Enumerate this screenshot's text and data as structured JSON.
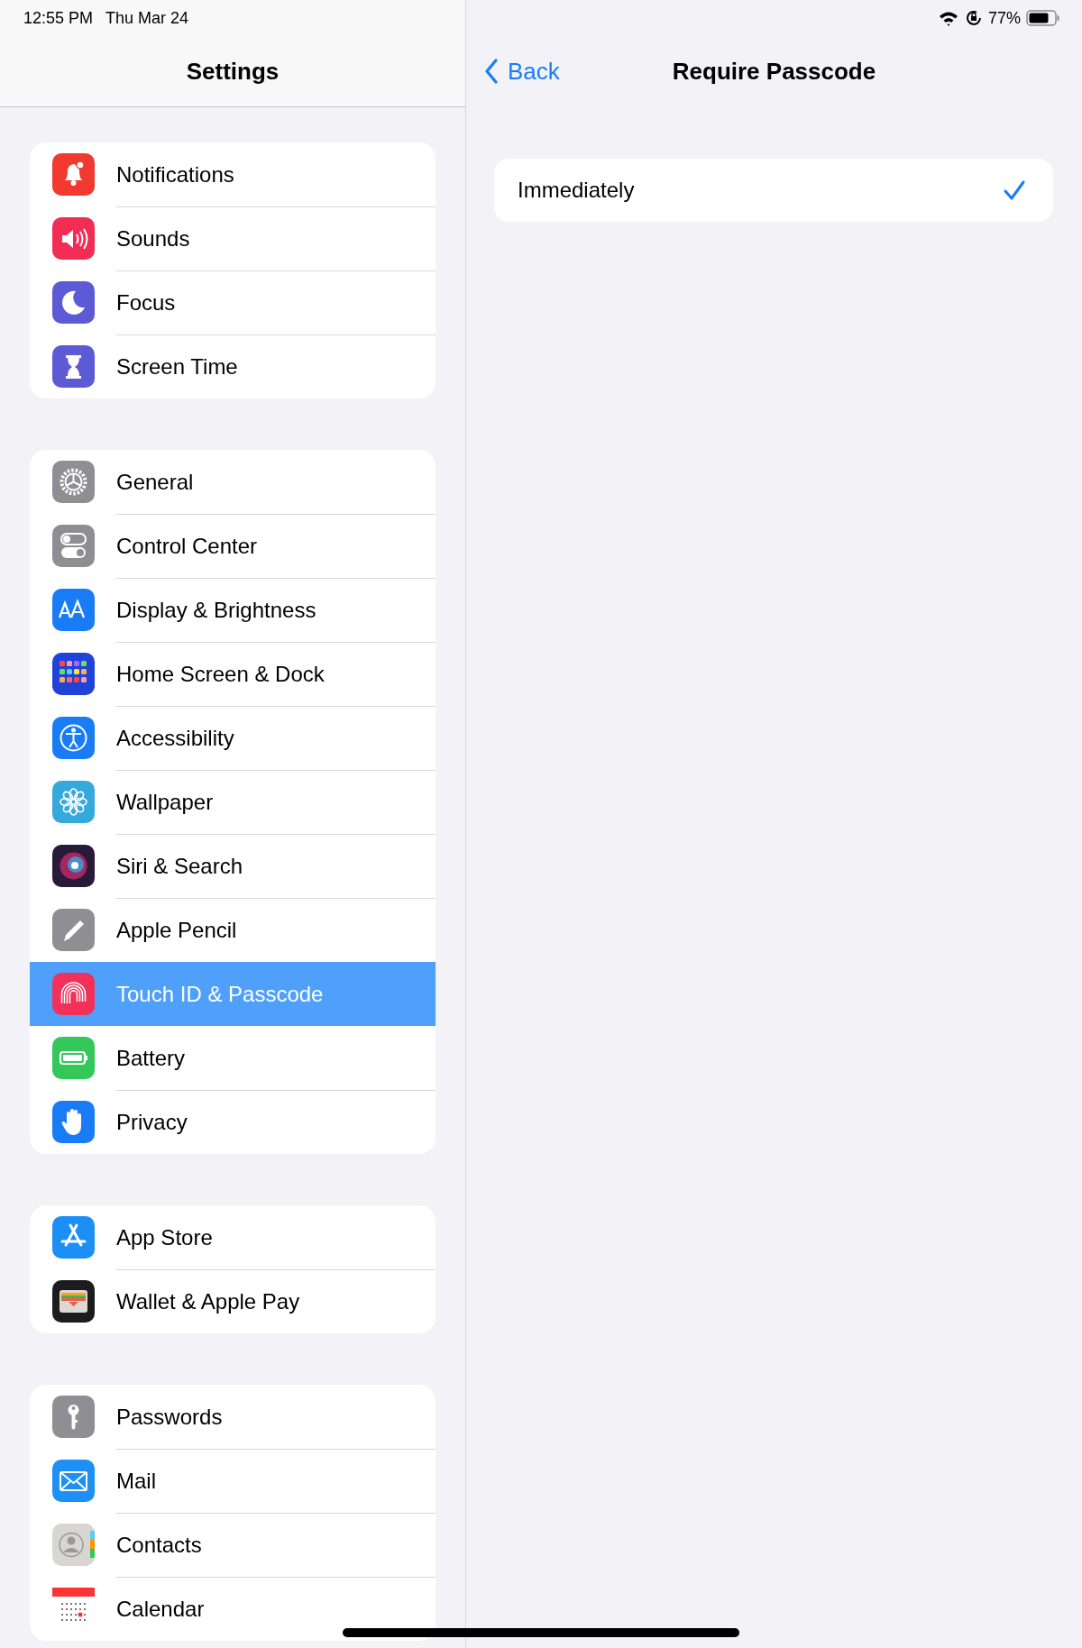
{
  "status_bar": {
    "time": "12:55 PM",
    "date": "Thu Mar 24",
    "battery": "77%"
  },
  "sidebar": {
    "title": "Settings",
    "groups": [
      {
        "items": [
          {
            "label": "Notifications",
            "kind": "bell",
            "color": "#f2392f",
            "selected": false
          },
          {
            "label": "Sounds",
            "kind": "speaker",
            "color": "#f22c55",
            "selected": false
          },
          {
            "label": "Focus",
            "kind": "moon",
            "color": "#5d5ad6",
            "selected": false
          },
          {
            "label": "Screen Time",
            "kind": "hourglass",
            "color": "#5d5ad6",
            "selected": false
          }
        ]
      },
      {
        "items": [
          {
            "label": "General",
            "kind": "gear",
            "color": "#8e8e93",
            "selected": false
          },
          {
            "label": "Control Center",
            "kind": "toggles",
            "color": "#8e8e93",
            "selected": false
          },
          {
            "label": "Display & Brightness",
            "kind": "textsize",
            "color": "#1a7cf5",
            "selected": false
          },
          {
            "label": "Home Screen & Dock",
            "kind": "grid",
            "color": "#1f43d8",
            "selected": false
          },
          {
            "label": "Accessibility",
            "kind": "accessibility",
            "color": "#1a7cf5",
            "selected": false
          },
          {
            "label": "Wallpaper",
            "kind": "flower",
            "color": "#36a9dc",
            "selected": false
          },
          {
            "label": "Siri & Search",
            "kind": "orb",
            "color": "#2a1a3a",
            "selected": false
          },
          {
            "label": "Apple Pencil",
            "kind": "pencil",
            "color": "#8e8e93",
            "selected": false
          },
          {
            "label": "Touch ID & Passcode",
            "kind": "fingerprint",
            "color": "#f2315a",
            "selected": true
          },
          {
            "label": "Battery",
            "kind": "battery",
            "color": "#34c759",
            "selected": false
          },
          {
            "label": "Privacy",
            "kind": "hand",
            "color": "#1a7cf5",
            "selected": false
          }
        ]
      },
      {
        "items": [
          {
            "label": "App Store",
            "kind": "appstore",
            "color": "#1b8ff5",
            "selected": false
          },
          {
            "label": "Wallet & Apple Pay",
            "kind": "wallet",
            "color": "#1c1c1e",
            "selected": false
          }
        ]
      },
      {
        "items": [
          {
            "label": "Passwords",
            "kind": "key",
            "color": "#8e8e93",
            "selected": false
          },
          {
            "label": "Mail",
            "kind": "envelope",
            "color": "#1e8ff5",
            "selected": false
          },
          {
            "label": "Contacts",
            "kind": "person",
            "color": "#d8d6d2",
            "selected": false
          },
          {
            "label": "Calendar",
            "kind": "calendar",
            "color": "#ffffff",
            "selected": false
          }
        ]
      }
    ]
  },
  "detail": {
    "back": "Back",
    "title": "Require Passcode",
    "options": [
      {
        "label": "Immediately",
        "selected": true
      }
    ]
  }
}
